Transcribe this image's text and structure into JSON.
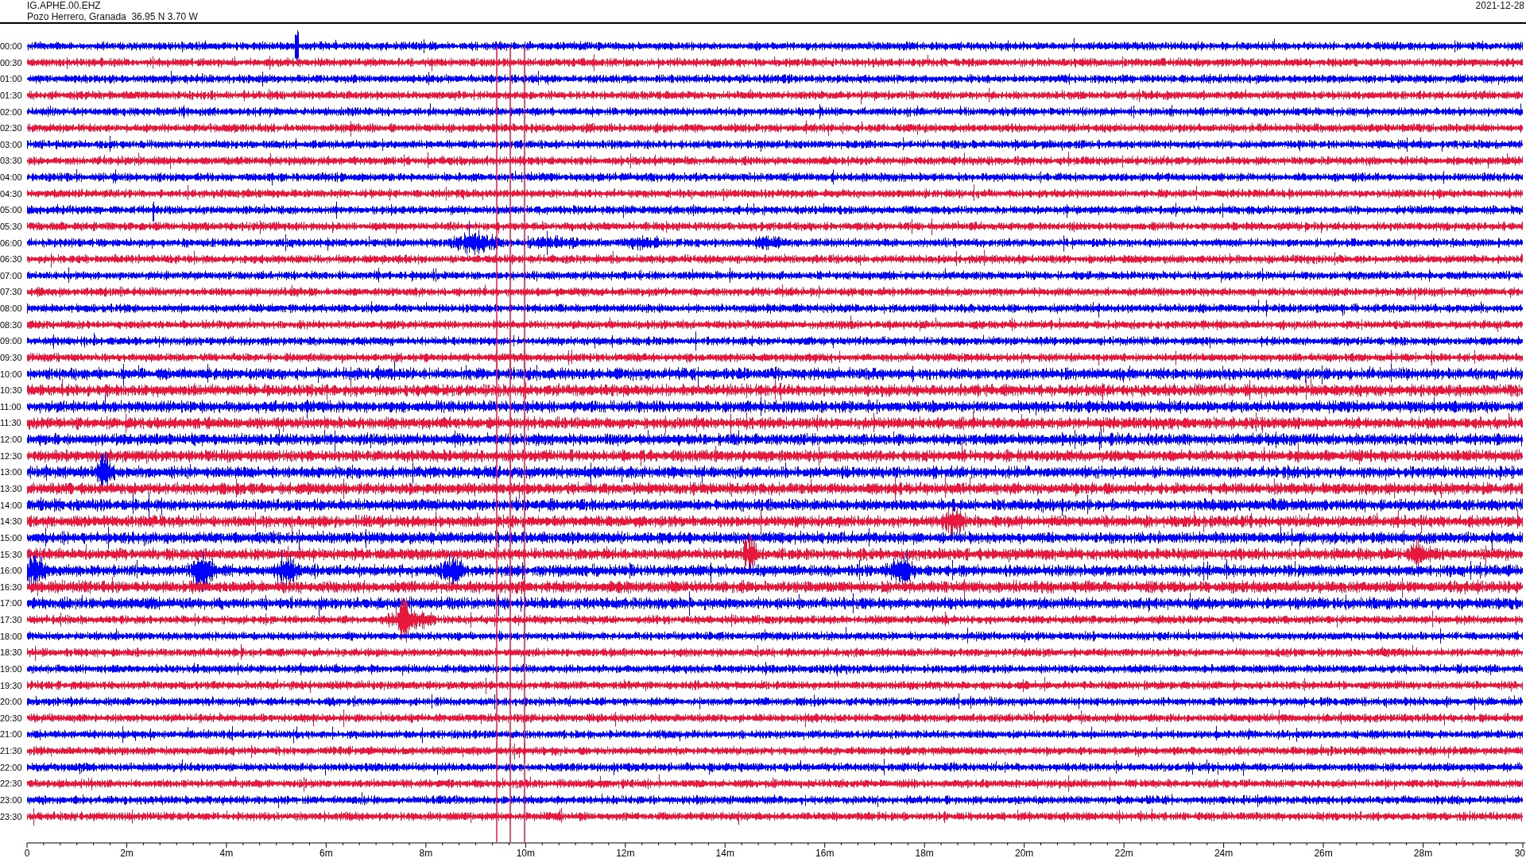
{
  "header": {
    "station": "IG.APHE.00.EHZ",
    "location": "Pozo Herrero, Granada  36.95 N 3.70 W",
    "date": "2021-12-28"
  },
  "rows": [
    {
      "label": "00:00",
      "color": "#0000ff"
    },
    {
      "label": "00:30",
      "color": "#e8173c"
    },
    {
      "label": "01:00",
      "color": "#0000ff"
    },
    {
      "label": "01:30",
      "color": "#e8173c"
    },
    {
      "label": "02:00",
      "color": "#0000ff"
    },
    {
      "label": "02:30",
      "color": "#e8173c"
    },
    {
      "label": "03:00",
      "color": "#0000ff"
    },
    {
      "label": "03:30",
      "color": "#e8173c"
    },
    {
      "label": "04:00",
      "color": "#0000ff"
    },
    {
      "label": "04:30",
      "color": "#e8173c"
    },
    {
      "label": "05:00",
      "color": "#0000ff"
    },
    {
      "label": "05:30",
      "color": "#e8173c"
    },
    {
      "label": "06:00",
      "color": "#0000ff"
    },
    {
      "label": "06:30",
      "color": "#e8173c"
    },
    {
      "label": "07:00",
      "color": "#0000ff"
    },
    {
      "label": "07:30",
      "color": "#e8173c"
    },
    {
      "label": "08:00",
      "color": "#0000ff"
    },
    {
      "label": "08:30",
      "color": "#e8173c"
    },
    {
      "label": "09:00",
      "color": "#0000ff"
    },
    {
      "label": "09:30",
      "color": "#e8173c"
    },
    {
      "label": "10:00",
      "color": "#0000ff"
    },
    {
      "label": "10:30",
      "color": "#e8173c"
    },
    {
      "label": "11:00",
      "color": "#0000ff"
    },
    {
      "label": "11:30",
      "color": "#e8173c"
    },
    {
      "label": "12:00",
      "color": "#0000ff"
    },
    {
      "label": "12:30",
      "color": "#e8173c"
    },
    {
      "label": "13:00",
      "color": "#0000ff"
    },
    {
      "label": "13:30",
      "color": "#e8173c"
    },
    {
      "label": "14:00",
      "color": "#0000ff"
    },
    {
      "label": "14:30",
      "color": "#e8173c"
    },
    {
      "label": "15:00",
      "color": "#0000ff"
    },
    {
      "label": "15:30",
      "color": "#e8173c"
    },
    {
      "label": "16:00",
      "color": "#0000ff"
    },
    {
      "label": "16:30",
      "color": "#e8173c"
    },
    {
      "label": "17:00",
      "color": "#0000ff"
    },
    {
      "label": "17:30",
      "color": "#e8173c"
    },
    {
      "label": "18:00",
      "color": "#0000ff"
    },
    {
      "label": "18:30",
      "color": "#e8173c"
    },
    {
      "label": "19:00",
      "color": "#0000ff"
    },
    {
      "label": "19:30",
      "color": "#e8173c"
    },
    {
      "label": "20:00",
      "color": "#0000ff"
    },
    {
      "label": "20:30",
      "color": "#e8173c"
    },
    {
      "label": "21:00",
      "color": "#0000ff"
    },
    {
      "label": "21:30",
      "color": "#e8173c"
    },
    {
      "label": "22:00",
      "color": "#0000ff"
    },
    {
      "label": "22:30",
      "color": "#e8173c"
    },
    {
      "label": "23:00",
      "color": "#0000ff"
    },
    {
      "label": "23:30",
      "color": "#e8173c"
    }
  ],
  "x_axis": {
    "ticks": [
      "0",
      "2m",
      "4m",
      "6m",
      "8m",
      "10m",
      "12m",
      "14m",
      "16m",
      "18m",
      "20m",
      "22m",
      "24m",
      "26m",
      "28m",
      "30"
    ]
  }
}
